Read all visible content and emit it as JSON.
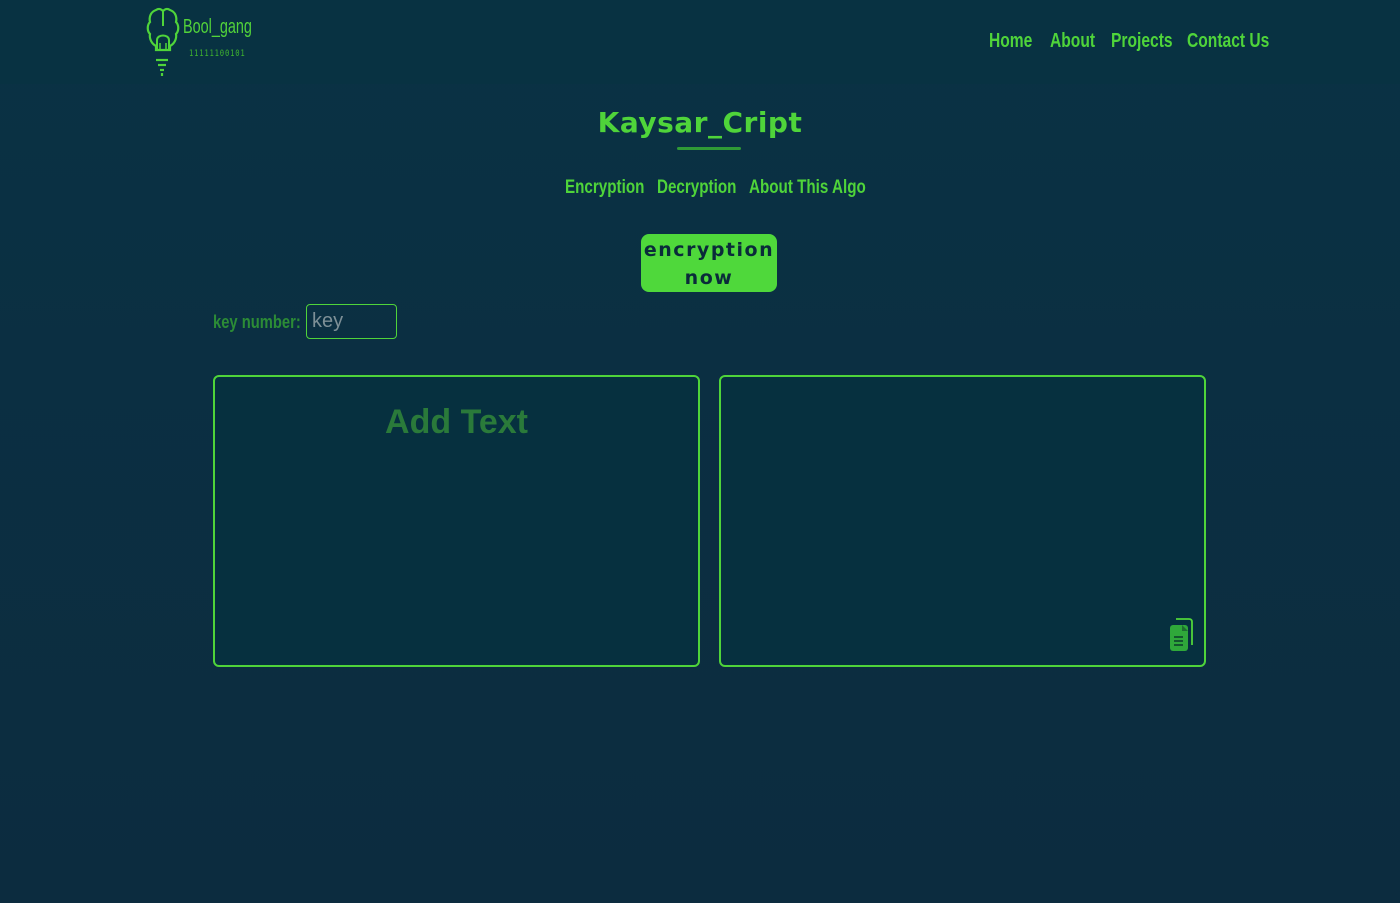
{
  "brand": {
    "name": "Bool_gang",
    "tagline": "11111100101",
    "logo_icon": "lightbulb-brain-icon"
  },
  "nav": {
    "items": [
      {
        "label": "Home"
      },
      {
        "label": "About"
      },
      {
        "label": "Projects"
      },
      {
        "label": "Contact Us"
      }
    ]
  },
  "page": {
    "title": "Kaysar_Cript"
  },
  "tabs": {
    "items": [
      {
        "label": "Encryption"
      },
      {
        "label": "Decryption"
      },
      {
        "label": "About This Algo"
      }
    ]
  },
  "action": {
    "line1": "encryption",
    "line2": "now"
  },
  "key": {
    "label": "key number:",
    "placeholder": "key",
    "value": ""
  },
  "input_panel": {
    "placeholder": "Add Text",
    "value": ""
  },
  "output_panel": {
    "value": "",
    "copy_icon": "copy-icon"
  },
  "colors": {
    "background": "#0b2f42",
    "accent": "#4fd43a",
    "button_text": "#0a2b3a",
    "muted_green": "#2a7a3a"
  }
}
